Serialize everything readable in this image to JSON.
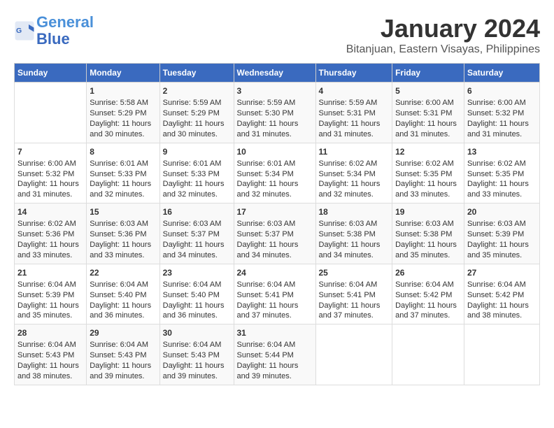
{
  "header": {
    "logo_line1": "General",
    "logo_line2": "Blue",
    "month": "January 2024",
    "location": "Bitanjuan, Eastern Visayas, Philippines"
  },
  "days_of_week": [
    "Sunday",
    "Monday",
    "Tuesday",
    "Wednesday",
    "Thursday",
    "Friday",
    "Saturday"
  ],
  "weeks": [
    [
      {
        "day": "",
        "content": ""
      },
      {
        "day": "1",
        "sunrise": "Sunrise: 5:58 AM",
        "sunset": "Sunset: 5:29 PM",
        "daylight": "Daylight: 11 hours and 30 minutes."
      },
      {
        "day": "2",
        "sunrise": "Sunrise: 5:59 AM",
        "sunset": "Sunset: 5:29 PM",
        "daylight": "Daylight: 11 hours and 30 minutes."
      },
      {
        "day": "3",
        "sunrise": "Sunrise: 5:59 AM",
        "sunset": "Sunset: 5:30 PM",
        "daylight": "Daylight: 11 hours and 31 minutes."
      },
      {
        "day": "4",
        "sunrise": "Sunrise: 5:59 AM",
        "sunset": "Sunset: 5:31 PM",
        "daylight": "Daylight: 11 hours and 31 minutes."
      },
      {
        "day": "5",
        "sunrise": "Sunrise: 6:00 AM",
        "sunset": "Sunset: 5:31 PM",
        "daylight": "Daylight: 11 hours and 31 minutes."
      },
      {
        "day": "6",
        "sunrise": "Sunrise: 6:00 AM",
        "sunset": "Sunset: 5:32 PM",
        "daylight": "Daylight: 11 hours and 31 minutes."
      }
    ],
    [
      {
        "day": "7",
        "sunrise": "Sunrise: 6:00 AM",
        "sunset": "Sunset: 5:32 PM",
        "daylight": "Daylight: 11 hours and 31 minutes."
      },
      {
        "day": "8",
        "sunrise": "Sunrise: 6:01 AM",
        "sunset": "Sunset: 5:33 PM",
        "daylight": "Daylight: 11 hours and 32 minutes."
      },
      {
        "day": "9",
        "sunrise": "Sunrise: 6:01 AM",
        "sunset": "Sunset: 5:33 PM",
        "daylight": "Daylight: 11 hours and 32 minutes."
      },
      {
        "day": "10",
        "sunrise": "Sunrise: 6:01 AM",
        "sunset": "Sunset: 5:34 PM",
        "daylight": "Daylight: 11 hours and 32 minutes."
      },
      {
        "day": "11",
        "sunrise": "Sunrise: 6:02 AM",
        "sunset": "Sunset: 5:34 PM",
        "daylight": "Daylight: 11 hours and 32 minutes."
      },
      {
        "day": "12",
        "sunrise": "Sunrise: 6:02 AM",
        "sunset": "Sunset: 5:35 PM",
        "daylight": "Daylight: 11 hours and 33 minutes."
      },
      {
        "day": "13",
        "sunrise": "Sunrise: 6:02 AM",
        "sunset": "Sunset: 5:35 PM",
        "daylight": "Daylight: 11 hours and 33 minutes."
      }
    ],
    [
      {
        "day": "14",
        "sunrise": "Sunrise: 6:02 AM",
        "sunset": "Sunset: 5:36 PM",
        "daylight": "Daylight: 11 hours and 33 minutes."
      },
      {
        "day": "15",
        "sunrise": "Sunrise: 6:03 AM",
        "sunset": "Sunset: 5:36 PM",
        "daylight": "Daylight: 11 hours and 33 minutes."
      },
      {
        "day": "16",
        "sunrise": "Sunrise: 6:03 AM",
        "sunset": "Sunset: 5:37 PM",
        "daylight": "Daylight: 11 hours and 34 minutes."
      },
      {
        "day": "17",
        "sunrise": "Sunrise: 6:03 AM",
        "sunset": "Sunset: 5:37 PM",
        "daylight": "Daylight: 11 hours and 34 minutes."
      },
      {
        "day": "18",
        "sunrise": "Sunrise: 6:03 AM",
        "sunset": "Sunset: 5:38 PM",
        "daylight": "Daylight: 11 hours and 34 minutes."
      },
      {
        "day": "19",
        "sunrise": "Sunrise: 6:03 AM",
        "sunset": "Sunset: 5:38 PM",
        "daylight": "Daylight: 11 hours and 35 minutes."
      },
      {
        "day": "20",
        "sunrise": "Sunrise: 6:03 AM",
        "sunset": "Sunset: 5:39 PM",
        "daylight": "Daylight: 11 hours and 35 minutes."
      }
    ],
    [
      {
        "day": "21",
        "sunrise": "Sunrise: 6:04 AM",
        "sunset": "Sunset: 5:39 PM",
        "daylight": "Daylight: 11 hours and 35 minutes."
      },
      {
        "day": "22",
        "sunrise": "Sunrise: 6:04 AM",
        "sunset": "Sunset: 5:40 PM",
        "daylight": "Daylight: 11 hours and 36 minutes."
      },
      {
        "day": "23",
        "sunrise": "Sunrise: 6:04 AM",
        "sunset": "Sunset: 5:40 PM",
        "daylight": "Daylight: 11 hours and 36 minutes."
      },
      {
        "day": "24",
        "sunrise": "Sunrise: 6:04 AM",
        "sunset": "Sunset: 5:41 PM",
        "daylight": "Daylight: 11 hours and 37 minutes."
      },
      {
        "day": "25",
        "sunrise": "Sunrise: 6:04 AM",
        "sunset": "Sunset: 5:41 PM",
        "daylight": "Daylight: 11 hours and 37 minutes."
      },
      {
        "day": "26",
        "sunrise": "Sunrise: 6:04 AM",
        "sunset": "Sunset: 5:42 PM",
        "daylight": "Daylight: 11 hours and 37 minutes."
      },
      {
        "day": "27",
        "sunrise": "Sunrise: 6:04 AM",
        "sunset": "Sunset: 5:42 PM",
        "daylight": "Daylight: 11 hours and 38 minutes."
      }
    ],
    [
      {
        "day": "28",
        "sunrise": "Sunrise: 6:04 AM",
        "sunset": "Sunset: 5:43 PM",
        "daylight": "Daylight: 11 hours and 38 minutes."
      },
      {
        "day": "29",
        "sunrise": "Sunrise: 6:04 AM",
        "sunset": "Sunset: 5:43 PM",
        "daylight": "Daylight: 11 hours and 39 minutes."
      },
      {
        "day": "30",
        "sunrise": "Sunrise: 6:04 AM",
        "sunset": "Sunset: 5:43 PM",
        "daylight": "Daylight: 11 hours and 39 minutes."
      },
      {
        "day": "31",
        "sunrise": "Sunrise: 6:04 AM",
        "sunset": "Sunset: 5:44 PM",
        "daylight": "Daylight: 11 hours and 39 minutes."
      },
      {
        "day": "",
        "content": ""
      },
      {
        "day": "",
        "content": ""
      },
      {
        "day": "",
        "content": ""
      }
    ]
  ],
  "colors": {
    "header_bg": "#3a6abf",
    "header_text": "#ffffff",
    "odd_row": "#f9f9f9",
    "even_row": "#ffffff"
  }
}
